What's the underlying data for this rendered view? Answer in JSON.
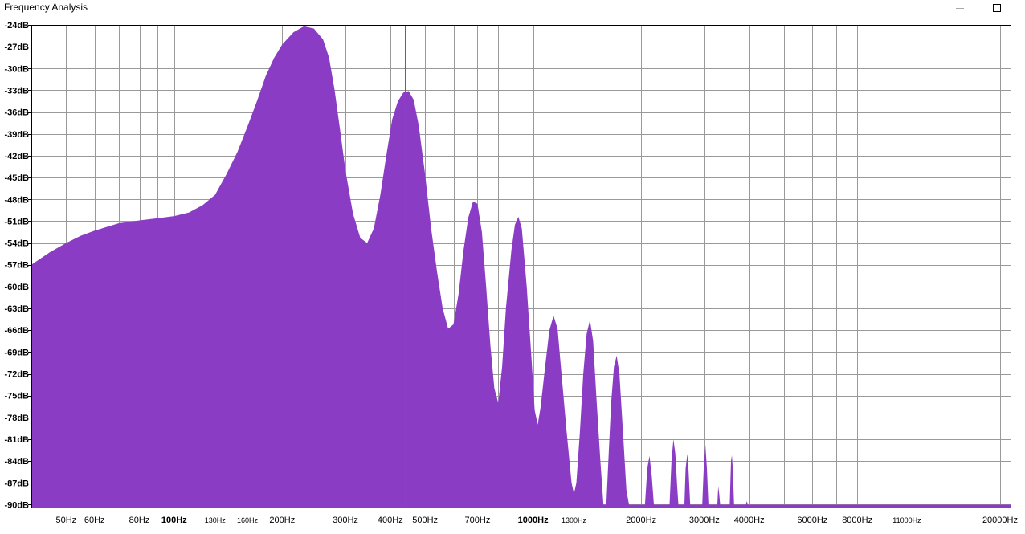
{
  "window": {
    "title": "Frequency Analysis",
    "minimize_icon": "minimize-icon",
    "maximize_icon": "maximize-icon"
  },
  "chart_data": {
    "type": "area",
    "title": "",
    "xlabel": "",
    "ylabel": "",
    "x_scale": "log",
    "xlim": [
      40,
      21500
    ],
    "ylim": [
      -90.5,
      -24
    ],
    "grid": true,
    "fill_color": "#8a3dc4",
    "cursor_color": "#e03030",
    "cursor_freq": 440,
    "y_ticks": [
      {
        "value": -24,
        "label": "-24dB"
      },
      {
        "value": -27,
        "label": "-27dB"
      },
      {
        "value": -30,
        "label": "-30dB"
      },
      {
        "value": -33,
        "label": "-33dB"
      },
      {
        "value": -36,
        "label": "-36dB"
      },
      {
        "value": -39,
        "label": "-39dB"
      },
      {
        "value": -42,
        "label": "-42dB"
      },
      {
        "value": -45,
        "label": "-45dB"
      },
      {
        "value": -48,
        "label": "-48dB"
      },
      {
        "value": -51,
        "label": "-51dB"
      },
      {
        "value": -54,
        "label": "-54dB"
      },
      {
        "value": -57,
        "label": "-57dB"
      },
      {
        "value": -60,
        "label": "-60dB"
      },
      {
        "value": -63,
        "label": "-63dB"
      },
      {
        "value": -66,
        "label": "-66dB"
      },
      {
        "value": -69,
        "label": "-69dB"
      },
      {
        "value": -72,
        "label": "-72dB"
      },
      {
        "value": -75,
        "label": "-75dB"
      },
      {
        "value": -78,
        "label": "-78dB"
      },
      {
        "value": -81,
        "label": "-81dB"
      },
      {
        "value": -84,
        "label": "-84dB"
      },
      {
        "value": -87,
        "label": "-87dB"
      },
      {
        "value": -90,
        "label": "-90dB"
      }
    ],
    "x_ticks": [
      {
        "value": 50,
        "label": "50Hz",
        "style": "normal"
      },
      {
        "value": 60,
        "label": "60Hz",
        "style": "normal"
      },
      {
        "value": 80,
        "label": "80Hz",
        "style": "normal"
      },
      {
        "value": 100,
        "label": "100Hz",
        "style": "bold"
      },
      {
        "value": 130,
        "label": "130Hz",
        "style": "small"
      },
      {
        "value": 160,
        "label": "160Hz",
        "style": "small"
      },
      {
        "value": 200,
        "label": "200Hz",
        "style": "normal"
      },
      {
        "value": 300,
        "label": "300Hz",
        "style": "normal"
      },
      {
        "value": 400,
        "label": "400Hz",
        "style": "normal"
      },
      {
        "value": 500,
        "label": "500Hz",
        "style": "normal"
      },
      {
        "value": 700,
        "label": "700Hz",
        "style": "normal"
      },
      {
        "value": 1000,
        "label": "1000Hz",
        "style": "bold"
      },
      {
        "value": 1300,
        "label": "1300Hz",
        "style": "small"
      },
      {
        "value": 2000,
        "label": "2000Hz",
        "style": "normal"
      },
      {
        "value": 3000,
        "label": "3000Hz",
        "style": "normal"
      },
      {
        "value": 4000,
        "label": "4000Hz",
        "style": "normal"
      },
      {
        "value": 6000,
        "label": "6000Hz",
        "style": "normal"
      },
      {
        "value": 8000,
        "label": "8000Hz",
        "style": "normal"
      },
      {
        "value": 11000,
        "label": "11000Hz",
        "style": "small"
      },
      {
        "value": 20000,
        "label": "20000Hz",
        "style": "normal"
      }
    ],
    "x_grid": [
      50,
      60,
      70,
      80,
      90,
      100,
      200,
      300,
      400,
      500,
      600,
      700,
      800,
      900,
      1000,
      2000,
      3000,
      4000,
      5000,
      6000,
      7000,
      8000,
      9000,
      10000,
      20000
    ],
    "series": [
      {
        "points": [
          [
            40,
            -57
          ],
          [
            45,
            -55.3
          ],
          [
            50,
            -54
          ],
          [
            55,
            -53
          ],
          [
            60,
            -52.3
          ],
          [
            70,
            -51.3
          ],
          [
            80,
            -50.9
          ],
          [
            90,
            -50.6
          ],
          [
            100,
            -50.3
          ],
          [
            110,
            -49.8
          ],
          [
            120,
            -48.8
          ],
          [
            130,
            -47.4
          ],
          [
            140,
            -44.5
          ],
          [
            150,
            -41.5
          ],
          [
            160,
            -38
          ],
          [
            170,
            -34.5
          ],
          [
            180,
            -31
          ],
          [
            190,
            -28.5
          ],
          [
            200,
            -26.7
          ],
          [
            215,
            -25
          ],
          [
            230,
            -24.2
          ],
          [
            245,
            -24.5
          ],
          [
            260,
            -26
          ],
          [
            270,
            -28.5
          ],
          [
            280,
            -33
          ],
          [
            290,
            -38.5
          ],
          [
            300,
            -44
          ],
          [
            315,
            -50
          ],
          [
            330,
            -53.3
          ],
          [
            345,
            -54
          ],
          [
            360,
            -52
          ],
          [
            375,
            -47.5
          ],
          [
            390,
            -42
          ],
          [
            405,
            -37
          ],
          [
            420,
            -34.5
          ],
          [
            435,
            -33.3
          ],
          [
            450,
            -33.1
          ],
          [
            465,
            -34.3
          ],
          [
            480,
            -37.8
          ],
          [
            500,
            -44.5
          ],
          [
            520,
            -52
          ],
          [
            540,
            -58
          ],
          [
            560,
            -63
          ],
          [
            580,
            -65.8
          ],
          [
            600,
            -65.2
          ],
          [
            620,
            -61
          ],
          [
            640,
            -55
          ],
          [
            660,
            -50.5
          ],
          [
            680,
            -48.3
          ],
          [
            700,
            -48.6
          ],
          [
            720,
            -52.5
          ],
          [
            740,
            -60
          ],
          [
            760,
            -68
          ],
          [
            780,
            -74
          ],
          [
            800,
            -76
          ],
          [
            820,
            -71
          ],
          [
            840,
            -63
          ],
          [
            870,
            -55
          ],
          [
            890,
            -51.5
          ],
          [
            910,
            -50.4
          ],
          [
            930,
            -52
          ],
          [
            960,
            -60
          ],
          [
            990,
            -70
          ],
          [
            1010,
            -77
          ],
          [
            1030,
            -79
          ],
          [
            1050,
            -76.5
          ],
          [
            1080,
            -71
          ],
          [
            1110,
            -66
          ],
          [
            1140,
            -64
          ],
          [
            1170,
            -65.8
          ],
          [
            1200,
            -72
          ],
          [
            1240,
            -80
          ],
          [
            1280,
            -87
          ],
          [
            1300,
            -88.5
          ],
          [
            1320,
            -87
          ],
          [
            1350,
            -80
          ],
          [
            1380,
            -72
          ],
          [
            1410,
            -66.5
          ],
          [
            1440,
            -64.6
          ],
          [
            1470,
            -67.5
          ],
          [
            1500,
            -75
          ],
          [
            1540,
            -84
          ],
          [
            1570,
            -90
          ],
          [
            1600,
            -90
          ],
          [
            1620,
            -84
          ],
          [
            1650,
            -76
          ],
          [
            1680,
            -71
          ],
          [
            1710,
            -69.5
          ],
          [
            1740,
            -72
          ],
          [
            1780,
            -80
          ],
          [
            1820,
            -88
          ],
          [
            1850,
            -90
          ],
          [
            2050,
            -90
          ],
          [
            2080,
            -85
          ],
          [
            2110,
            -83.3
          ],
          [
            2140,
            -86
          ],
          [
            2170,
            -90
          ],
          [
            2400,
            -90
          ],
          [
            2430,
            -84
          ],
          [
            2460,
            -81
          ],
          [
            2490,
            -83
          ],
          [
            2520,
            -87.5
          ],
          [
            2540,
            -90
          ],
          [
            2640,
            -90
          ],
          [
            2660,
            -85
          ],
          [
            2690,
            -83
          ],
          [
            2710,
            -85.2
          ],
          [
            2740,
            -90
          ],
          [
            2960,
            -90
          ],
          [
            2990,
            -84.5
          ],
          [
            3020,
            -81.8
          ],
          [
            3050,
            -85
          ],
          [
            3080,
            -90
          ],
          [
            3260,
            -90
          ],
          [
            3280,
            -87.5
          ],
          [
            3300,
            -88.5
          ],
          [
            3320,
            -90
          ],
          [
            3530,
            -90
          ],
          [
            3560,
            -84
          ],
          [
            3580,
            -83.2
          ],
          [
            3600,
            -85
          ],
          [
            3630,
            -90
          ],
          [
            3920,
            -90
          ],
          [
            3940,
            -89.5
          ],
          [
            3960,
            -90
          ],
          [
            21500,
            -90
          ]
        ]
      }
    ]
  }
}
